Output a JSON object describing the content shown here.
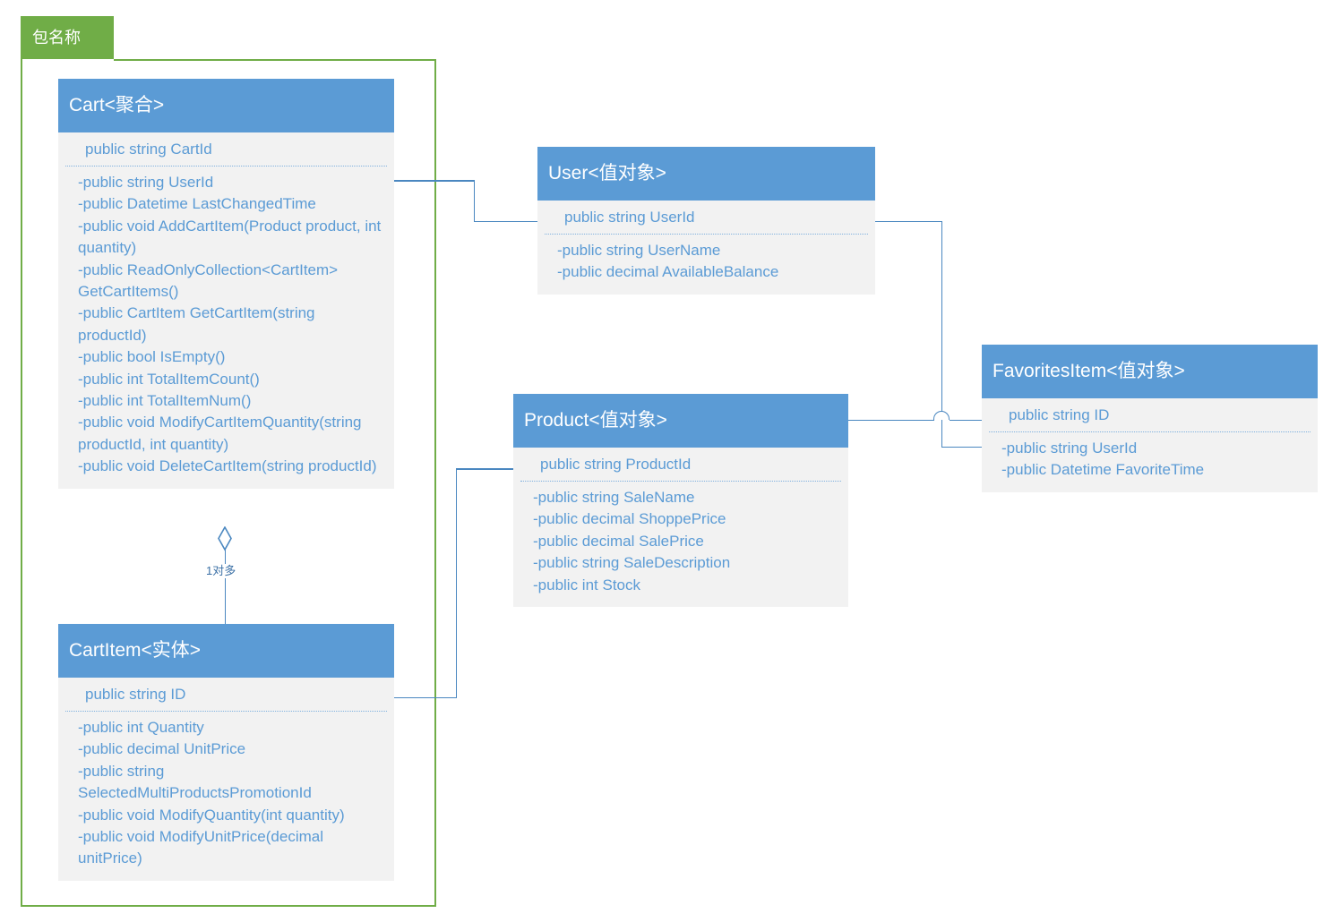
{
  "package": {
    "tab_label": "包名称"
  },
  "classes": [
    {
      "id": "cart",
      "title": "Cart<聚合>",
      "key": "public string CartId",
      "members": [
        "-public string UserId",
        "-public Datetime LastChangedTime",
        "-public void AddCartItem(Product product, int quantity)",
        "-public ReadOnlyCollection<CartItem> GetCartItems()",
        "-public CartItem GetCartItem(string productId)",
        "-public bool IsEmpty()",
        "-public int TotalItemCount()",
        "-public int TotalItemNum()",
        "-public void ModifyCartItemQuantity(string productId, int quantity)",
        "-public void DeleteCartItem(string productId)"
      ]
    },
    {
      "id": "user",
      "title": "User<值对象>",
      "key": "public string UserId",
      "members": [
        "-public string UserName",
        "-public decimal AvailableBalance"
      ]
    },
    {
      "id": "favoritesitem",
      "title": "FavoritesItem<值对象>",
      "key": "public string ID",
      "members": [
        "-public string UserId",
        "-public Datetime FavoriteTime"
      ]
    },
    {
      "id": "product",
      "title": "Product<值对象>",
      "key": "public string ProductId",
      "members": [
        "-public string SaleName",
        "-public decimal ShoppePrice",
        "-public decimal SalePrice",
        "-public string SaleDescription",
        "-public int Stock"
      ]
    },
    {
      "id": "cartitem",
      "title": "CartItem<实体>",
      "key": "public string ID",
      "members": [
        "-public int Quantity",
        "-public decimal UnitPrice",
        "-public string SelectedMultiProductsPromotionId",
        "-public void ModifyQuantity(int quantity)",
        "-public void ModifyUnitPrice(decimal unitPrice)"
      ]
    }
  ],
  "relationships": [
    {
      "id": "cart-cartitem",
      "label": "1对多",
      "kind": "aggregation",
      "from": "cart",
      "to": "cartitem"
    }
  ],
  "colors": {
    "header_blue": "#5B9BD5",
    "body_gray": "#F2F2F2",
    "package_green": "#70AD47",
    "connector_blue": "#4A87C0",
    "text_blue": "#5B9BD5",
    "header_text": "#FFFFFF"
  }
}
